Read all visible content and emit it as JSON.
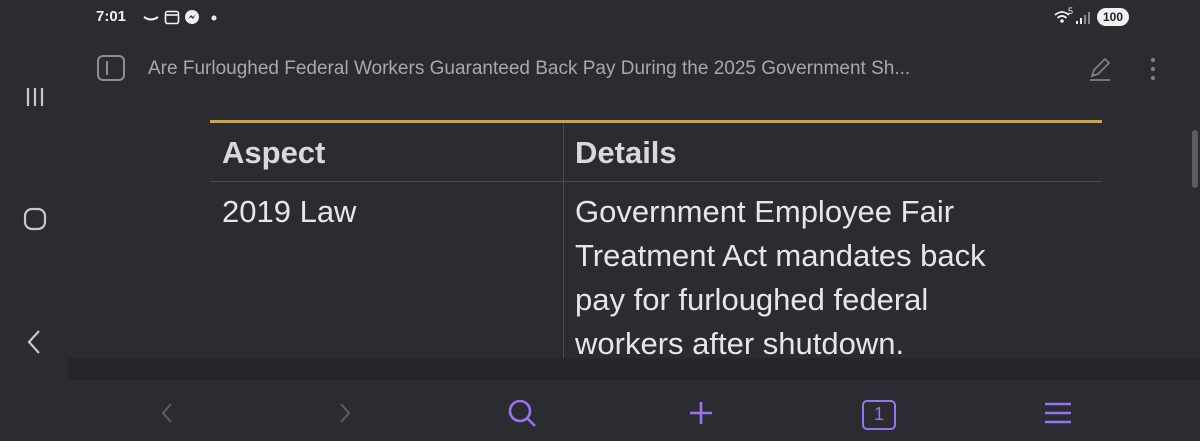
{
  "status_bar": {
    "time": "7:01",
    "battery": "100",
    "signal_label": "5"
  },
  "browser": {
    "page_title": "Are Furloughed Federal Workers Guaranteed Back Pay During the 2025 Government Sh..."
  },
  "table": {
    "headers": [
      "Aspect",
      "Details"
    ],
    "rows": [
      {
        "aspect": "2019 Law",
        "details_lines": [
          "Government Employee Fair",
          "Treatment Act mandates back",
          "pay for furloughed federal",
          "workers after shutdown."
        ]
      }
    ]
  },
  "bottom_bar": {
    "tabs_count": "1"
  },
  "colors": {
    "background": "#2b2c31",
    "accent": "#9a73f0",
    "table_border": "#c9a35a"
  }
}
